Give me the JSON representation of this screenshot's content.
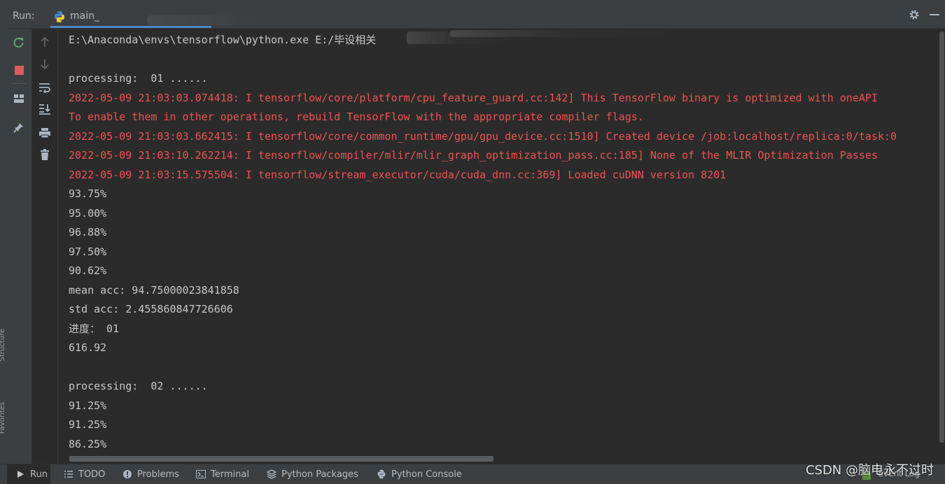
{
  "side_labels": [
    "Structure",
    "Favorites"
  ],
  "header": {
    "run_label": "Run:",
    "tab_label": "main_",
    "icons": [
      "python-icon",
      "gear-icon",
      "minimize-icon"
    ]
  },
  "toolbar": {
    "icons": [
      "rerun-icon",
      "stop-icon",
      "layout-icon",
      "pin-icon",
      "up-arrow-icon",
      "down-arrow-icon",
      "soft-wrap-icon",
      "scroll-to-end-icon",
      "print-icon",
      "trash-icon"
    ]
  },
  "console": {
    "lines": [
      {
        "text": "E:\\Anaconda\\envs\\tensorflow\\python.exe E:/毕设相关",
        "kind": "normal"
      },
      {
        "text": "",
        "kind": "normal"
      },
      {
        "text": "processing:  01 ......",
        "kind": "normal"
      },
      {
        "text": "2022-05-09 21:03:03.074418: I tensorflow/core/platform/cpu_feature_guard.cc:142] This TensorFlow binary is optimized with oneAPI",
        "kind": "err"
      },
      {
        "text": "To enable them in other operations, rebuild TensorFlow with the appropriate compiler flags.",
        "kind": "err"
      },
      {
        "text": "2022-05-09 21:03:03.662415: I tensorflow/core/common_runtime/gpu/gpu_device.cc:1510] Created device /job:localhost/replica:0/task:0",
        "kind": "err"
      },
      {
        "text": "2022-05-09 21:03:10.262214: I tensorflow/compiler/mlir/mlir_graph_optimization_pass.cc:185] None of the MLIR Optimization Passes",
        "kind": "err"
      },
      {
        "text": "2022-05-09 21:03:15.575504: I tensorflow/stream_executor/cuda/cuda_dnn.cc:369] Loaded cuDNN version 8201",
        "kind": "err"
      },
      {
        "text": "93.75%",
        "kind": "normal"
      },
      {
        "text": "95.00%",
        "kind": "normal"
      },
      {
        "text": "96.88%",
        "kind": "normal"
      },
      {
        "text": "97.50%",
        "kind": "normal"
      },
      {
        "text": "90.62%",
        "kind": "normal"
      },
      {
        "text": "mean acc: 94.75000023841858",
        "kind": "normal"
      },
      {
        "text": "std acc: 2.455860847726606",
        "kind": "normal"
      },
      {
        "text": "进度： 01",
        "kind": "normal"
      },
      {
        "text": "616.92",
        "kind": "normal"
      },
      {
        "text": "",
        "kind": "normal"
      },
      {
        "text": "processing:  02 ......",
        "kind": "normal"
      },
      {
        "text": "91.25%",
        "kind": "normal"
      },
      {
        "text": "91.25%",
        "kind": "normal"
      },
      {
        "text": "86.25%",
        "kind": "normal"
      }
    ]
  },
  "bottom_tabs": [
    {
      "label": "Run",
      "icon": "run-icon",
      "active": true
    },
    {
      "label": "TODO",
      "icon": "todo-list-icon",
      "active": false
    },
    {
      "label": "Problems",
      "icon": "problems-icon",
      "active": false
    },
    {
      "label": "Terminal",
      "icon": "terminal-icon",
      "active": false
    },
    {
      "label": "Python Packages",
      "icon": "packages-icon",
      "active": false
    },
    {
      "label": "Python Console",
      "icon": "python-console-icon",
      "active": false
    }
  ],
  "status": {
    "event_log": "Event Log",
    "watermark": "CSDN @脑电永不过时"
  },
  "colors": {
    "background": "#2b2b2b",
    "panel": "#3c3f41",
    "error_text": "#f0524f",
    "normal_text": "#c8c8c8",
    "accent": "#4a88c7"
  }
}
